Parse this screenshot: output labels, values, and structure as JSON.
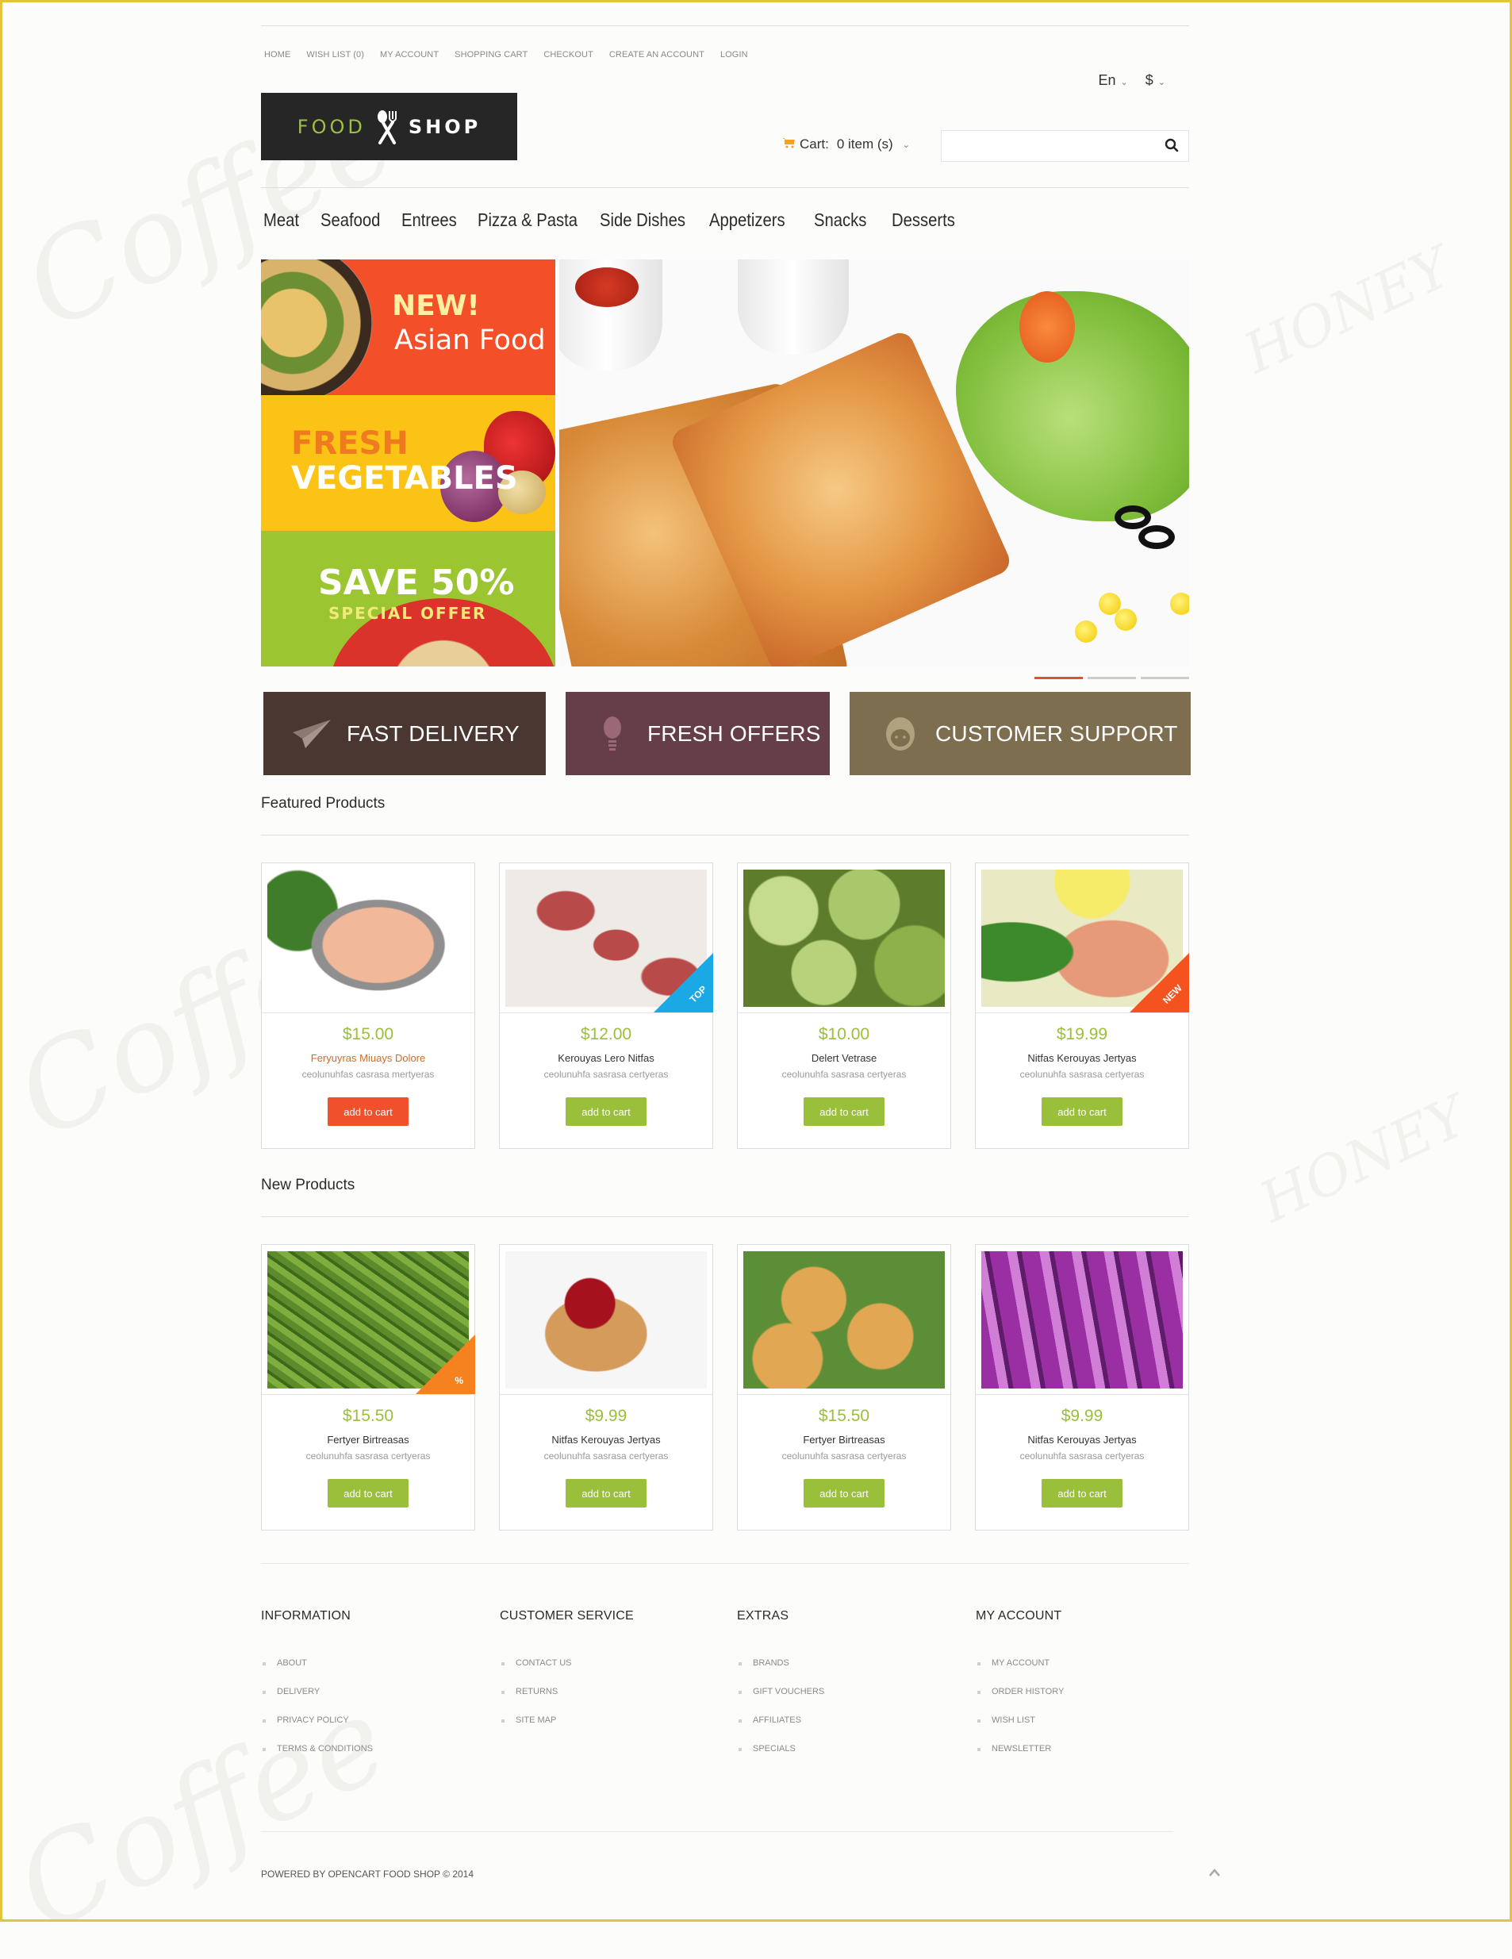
{
  "top_links": [
    "HOME",
    "WISH LIST (0)",
    "MY ACCOUNT",
    "SHOPPING CART",
    "CHECKOUT",
    "CREATE AN ACCOUNT",
    "LOGIN"
  ],
  "language": {
    "selected": "En",
    "icon": "chevron-down-icon"
  },
  "currency": {
    "selected": "$",
    "icon": "chevron-down-icon"
  },
  "logo": {
    "word1": "FOOD",
    "word2": "SHOP",
    "icon": "spoon-fork-icon"
  },
  "cart": {
    "label": "Cart:",
    "value": "0 item (s)",
    "icon": "cart-icon"
  },
  "search": {
    "placeholder": "",
    "value": "",
    "icon": "search-icon"
  },
  "categories": [
    "Meat",
    "Seafood",
    "Entrees",
    "Pizza & Pasta",
    "Side Dishes",
    "Appetizers",
    "Snacks",
    "Desserts"
  ],
  "promos": [
    {
      "line1": "NEW!",
      "line2": "Asian Food"
    },
    {
      "line1": "FRESH",
      "line2": "VEGETABLES"
    },
    {
      "line1": "SAVE 50%",
      "line2": "SPECIAL OFFER"
    }
  ],
  "slider": {
    "slides": 3,
    "active": 1
  },
  "features": [
    {
      "label": "FAST DELIVERY",
      "icon": "paper-plane-icon"
    },
    {
      "label": "FRESH OFFERS",
      "icon": "lightbulb-icon"
    },
    {
      "label": "CUSTOMER SUPPORT",
      "icon": "support-agent-icon"
    }
  ],
  "featured": {
    "title": "Featured Products",
    "products": [
      {
        "price": "$15.00",
        "name": "Feryuyras Miuays Dolore",
        "desc": "ceolunuhfas casrasa mertyeras",
        "button": "add to cart",
        "badge": ""
      },
      {
        "price": "$12.00",
        "name": "Kerouyas Lero Nitfas",
        "desc": "ceolunuhfa sasrasa certyeras",
        "button": "add to cart",
        "badge": "TOP"
      },
      {
        "price": "$10.00",
        "name": "Delert Vetrase",
        "desc": "ceolunuhfa sasrasa certyeras",
        "button": "add to cart",
        "badge": ""
      },
      {
        "price": "$19.99",
        "name": "Nitfas Kerouyas Jertyas",
        "desc": "ceolunuhfa sasrasa certyeras",
        "button": "add to cart",
        "badge": "NEW"
      }
    ]
  },
  "new_products": {
    "title": "New Products",
    "products": [
      {
        "price": "$15.50",
        "name": "Fertyer Birtreasas",
        "desc": "ceolunuhfa sasrasa certyeras",
        "button": "add to cart",
        "badge": "%"
      },
      {
        "price": "$9.99",
        "name": "Nitfas Kerouyas Jertyas",
        "desc": "ceolunuhfa sasrasa certyeras",
        "button": "add to cart",
        "badge": ""
      },
      {
        "price": "$15.50",
        "name": "Fertyer Birtreasas",
        "desc": "ceolunuhfa sasrasa certyeras",
        "button": "add to cart",
        "badge": ""
      },
      {
        "price": "$9.99",
        "name": "Nitfas Kerouyas Jertyas",
        "desc": "ceolunuhfa sasrasa certyeras",
        "button": "add to cart",
        "badge": ""
      }
    ]
  },
  "footer": {
    "columns": [
      {
        "title": "INFORMATION",
        "links": [
          "ABOUT",
          "DELIVERY",
          "PRIVACY POLICY",
          "TERMS & CONDITIONS"
        ]
      },
      {
        "title": "CUSTOMER SERVICE",
        "links": [
          "CONTACT US",
          "RETURNS",
          "SITE MAP"
        ]
      },
      {
        "title": "EXTRAS",
        "links": [
          "BRANDS",
          "GIFT VOUCHERS",
          "AFFILIATES",
          "SPECIALS"
        ]
      },
      {
        "title": "MY ACCOUNT",
        "links": [
          "MY ACCOUNT",
          "ORDER HISTORY",
          "WISH LIST",
          "NEWSLETTER"
        ]
      }
    ],
    "copyright": "POWERED BY OPENCART FOOD SHOP © 2014",
    "to_top_icon": "chevron-up-icon"
  },
  "colors": {
    "accent_green": "#9abf3b",
    "accent_red": "#f1502c",
    "feature_delivery": "#4b3731",
    "feature_offers": "#663e4a",
    "feature_support": "#7d6e4f",
    "frame": "#e5c240"
  }
}
